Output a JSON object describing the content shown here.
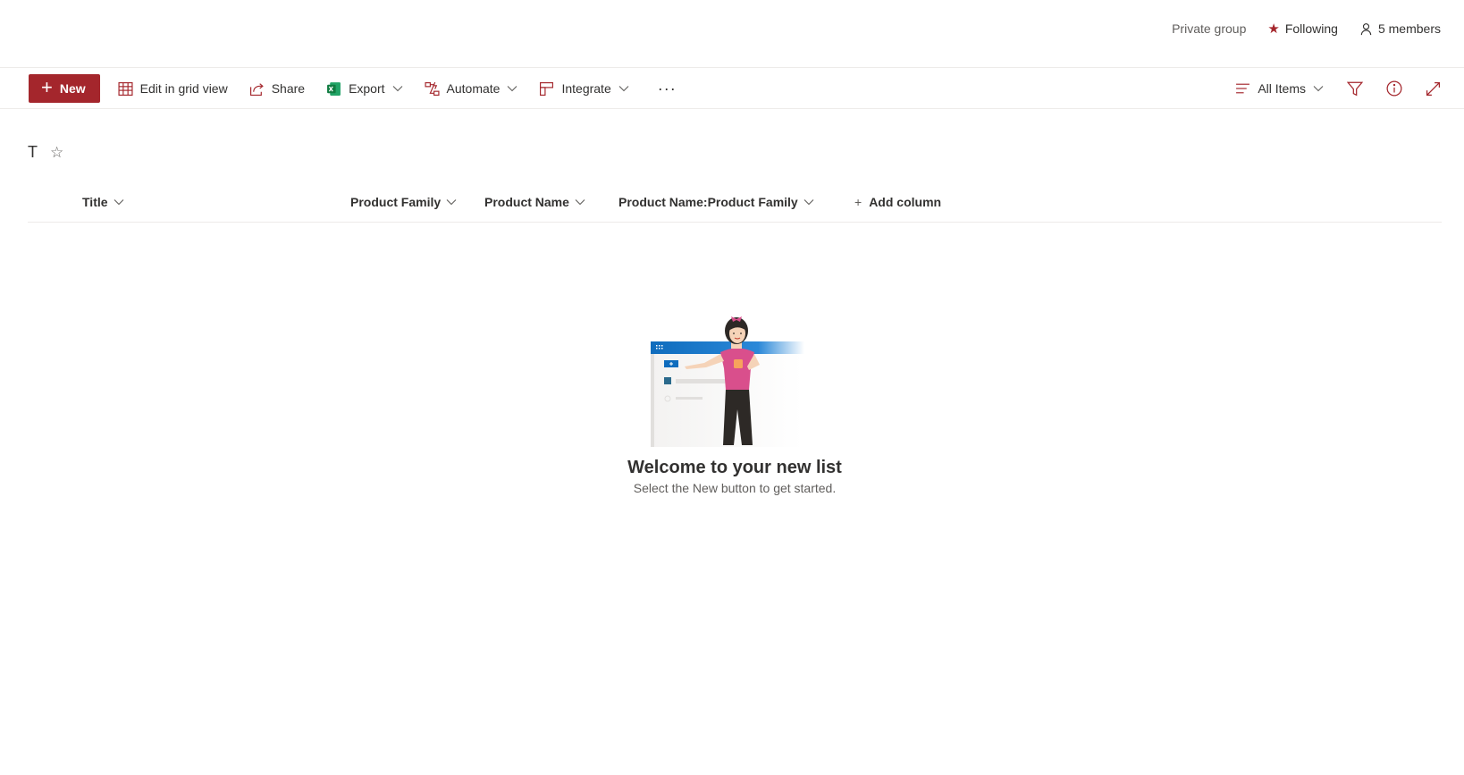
{
  "topbar": {
    "privacy": "Private group",
    "following": "Following",
    "members": "5 members"
  },
  "commands": {
    "new": "New",
    "edit_grid": "Edit in grid view",
    "share": "Share",
    "export": "Export",
    "automate": "Automate",
    "integrate": "Integrate",
    "more": "···",
    "view": "All Items"
  },
  "list": {
    "title": "T"
  },
  "columns": {
    "title": "Title",
    "product_family": "Product Family",
    "product_name": "Product Name",
    "combined": "Product Name:Product Family",
    "add": "Add column"
  },
  "empty_state": {
    "title": "Welcome to your new list",
    "subtitle": "Select the New button to get started."
  },
  "colors": {
    "accent": "#a4262c",
    "text": "#323130",
    "secondary": "#605e5c",
    "border": "#edebe9"
  }
}
